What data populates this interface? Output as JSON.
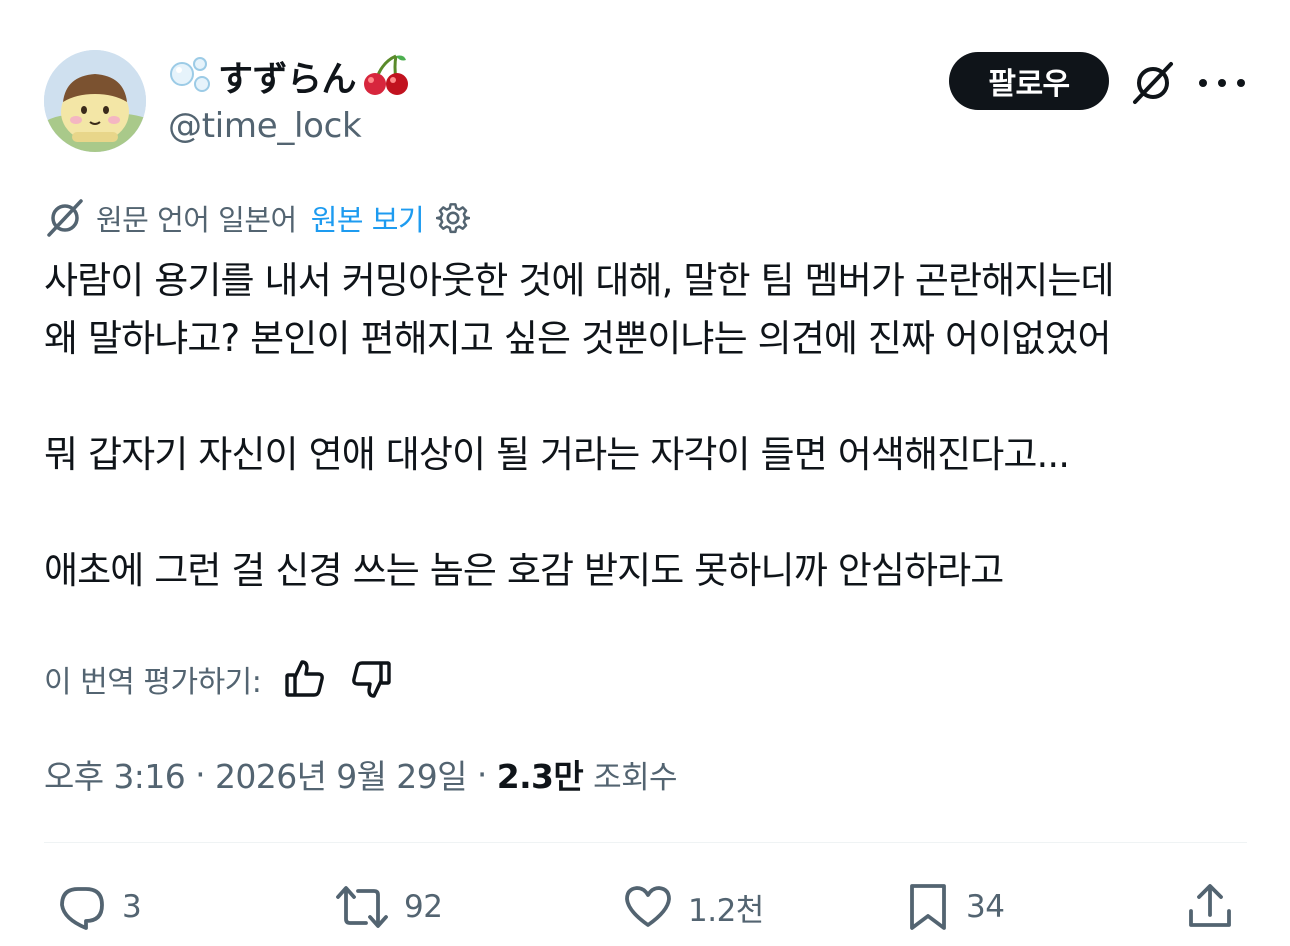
{
  "author": {
    "display_name": "すずらん",
    "handle": "@time_lock"
  },
  "header": {
    "follow_label": "팔로우"
  },
  "translation": {
    "source_label": "원문 언어 일본어",
    "view_original_label": "원본 보기",
    "rate_label": "이 번역 평가하기:"
  },
  "tweet": {
    "lines": [
      "사람이 용기를 내서 커밍아웃한 것에 대해, 말한 팀 멤버가 곤란해지는데",
      "왜 말하냐고? 본인이 편해지고 싶은 것뿐이냐는 의견에 진짜 어이없었어",
      "",
      "뭐 갑자기 자신이 연애 대상이 될 거라는 자각이 들면 어색해진다고...",
      "",
      "애초에 그런 걸 신경 쓰는 놈은 호감 받지도 못하니까 안심하라고"
    ]
  },
  "meta": {
    "time": "오후 3:16",
    "separator": "·",
    "date": "2026년 9월 29일",
    "views_count": "2.3만",
    "views_label": "조회수"
  },
  "actions": {
    "replies": "3",
    "reposts": "92",
    "likes": "1.2천",
    "bookmarks": "34"
  },
  "colors": {
    "text": "#0f1419",
    "secondary": "#536471",
    "link": "#1d9bf0",
    "divider": "#eff3f4"
  },
  "icons": [
    "grok-icon",
    "more-icon",
    "translate-icon",
    "gear-icon",
    "thumbs-up-icon",
    "thumbs-down-icon",
    "reply-icon",
    "repost-icon",
    "like-icon",
    "bookmark-icon",
    "share-icon"
  ]
}
